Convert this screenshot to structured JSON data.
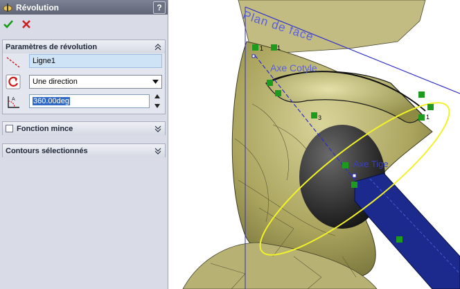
{
  "panel": {
    "title": "Révolution",
    "help_label": "?",
    "groups": {
      "params": {
        "title": "Paramètres de révolution",
        "axis_value": "Ligne1",
        "direction_value": "Une direction",
        "angle_value": "360.00deg"
      },
      "thin": {
        "title": "Fonction mince"
      },
      "contours": {
        "title": "Contours sélectionnés"
      }
    }
  },
  "viewport": {
    "labels": {
      "plane": "Plan de face",
      "cotyle_axis": "Axe Cotyle",
      "tige_axis": "Axe Tige"
    },
    "relation_numbers": [
      "1",
      "1",
      "3",
      "1"
    ]
  },
  "colors": {
    "model_surface": "#b3ad6a",
    "stem_blue": "#1b2a8c",
    "selection_yellow": "#f2f22a",
    "sketch_blue": "#2d2dc9",
    "confirm_green": "#1a9a1a",
    "cancel_red": "#cc1f1f"
  }
}
